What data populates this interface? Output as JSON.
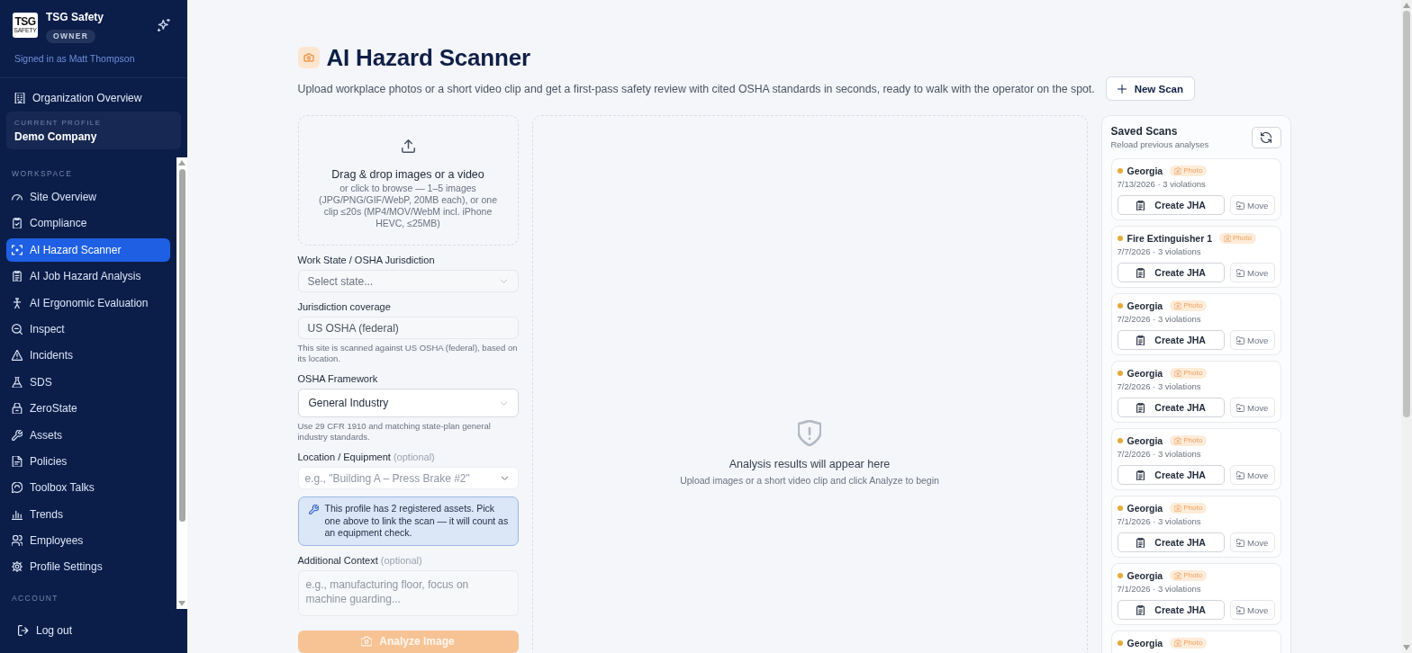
{
  "sidebar": {
    "brand": {
      "logo": {
        "wordmark": "TSG",
        "tagline": "SAFETY"
      },
      "name": "TSG Safety",
      "role": "OWNER"
    },
    "signed_in": "Signed in as Matt Thompson",
    "org_link": "Organization Overview",
    "current_profile": {
      "label": "CURRENT PROFILE",
      "name": "Demo Company"
    },
    "sections": [
      {
        "title": "WORKSPACE",
        "items": [
          {
            "label": "Site Overview",
            "selected": false
          },
          {
            "label": "Compliance",
            "selected": false
          },
          {
            "label": "AI Hazard Scanner",
            "selected": true
          },
          {
            "label": "AI Job Hazard Analysis",
            "selected": false
          },
          {
            "label": "AI Ergonomic Evaluation",
            "selected": false
          },
          {
            "label": "Inspect",
            "selected": false
          },
          {
            "label": "Incidents",
            "selected": false
          },
          {
            "label": "SDS",
            "selected": false
          },
          {
            "label": "ZeroState",
            "selected": false
          },
          {
            "label": "Assets",
            "selected": false
          },
          {
            "label": "Policies",
            "selected": false
          },
          {
            "label": "Toolbox Talks",
            "selected": false
          },
          {
            "label": "Trends",
            "selected": false
          },
          {
            "label": "Employees",
            "selected": false
          },
          {
            "label": "Profile Settings",
            "selected": false
          }
        ]
      },
      {
        "title": "ACCOUNT"
      }
    ],
    "logout": "Log out"
  },
  "header": {
    "title": "AI Hazard Scanner",
    "description": "Upload workplace photos or a short video clip and get a first-pass safety review with cited OSHA standards in seconds, ready to walk with the operator on the spot.",
    "new_scan": "New Scan"
  },
  "upload": {
    "title": "Drag & drop images or a video",
    "hint": "or click to browse — 1–5 images (JPG/PNG/GIF/WebP, 20MB each), or one clip ≤20s (MP4/MOV/WebM incl. iPhone HEVC, ≤25MB)"
  },
  "form": {
    "fields": [
      {
        "kind": "select",
        "label": "Work State / OSHA Jurisdiction",
        "placeholder": "Select state..."
      },
      {
        "kind": "readonly",
        "label": "Jurisdiction coverage",
        "value": "US OSHA (federal)",
        "help": "This site is scanned against US OSHA (federal), based on its location."
      },
      {
        "kind": "select",
        "label": "OSHA Framework",
        "value": "General Industry",
        "help": "Use 29 CFR 1910 and matching state-plan general industry standards."
      },
      {
        "kind": "combobox",
        "label": "Location / Equipment",
        "note": "(optional)",
        "placeholder": "e.g., \"Building A – Press Brake #2\"",
        "info": "This profile has 2 registered assets. Pick one above to link the scan — it will count as an equipment check."
      },
      {
        "kind": "textarea",
        "label": "Additional Context",
        "note": "(optional)",
        "placeholder": "e.g., manufacturing floor, focus on machine guarding..."
      }
    ],
    "analyze_button": {
      "label": "Analyze Image",
      "disabled": true
    }
  },
  "results": {
    "title": "Analysis results will appear here",
    "hint": "Upload images or a short video clip and click Analyze to begin"
  },
  "saved_scans": {
    "title": "Saved Scans",
    "subtitle": "Reload previous analyses",
    "scans": [
      {
        "name": "Georgia",
        "media": "Photo",
        "meta": "7/13/2026 · 3 violations",
        "create": "Create JHA",
        "move": "Move"
      },
      {
        "name": "Fire Extinguisher 1",
        "media": "Photo",
        "meta": "7/7/2026 · 3 violations",
        "create": "Create JHA",
        "move": "Move"
      },
      {
        "name": "Georgia",
        "media": "Photo",
        "meta": "7/2/2026 · 3 violations",
        "create": "Create JHA",
        "move": "Move"
      },
      {
        "name": "Georgia",
        "media": "Photo",
        "meta": "7/2/2026 · 3 violations",
        "create": "Create JHA",
        "move": "Move"
      },
      {
        "name": "Georgia",
        "media": "Photo",
        "meta": "7/2/2026 · 3 violations",
        "create": "Create JHA",
        "move": "Move"
      },
      {
        "name": "Georgia",
        "media": "Photo",
        "meta": "7/1/2026 · 3 violations",
        "create": "Create JHA",
        "move": "Move"
      },
      {
        "name": "Georgia",
        "media": "Photo",
        "meta": "7/1/2026 · 3 violations",
        "create": "Create JHA",
        "move": "Move"
      },
      {
        "name": "Georgia",
        "media": "Photo"
      }
    ]
  }
}
